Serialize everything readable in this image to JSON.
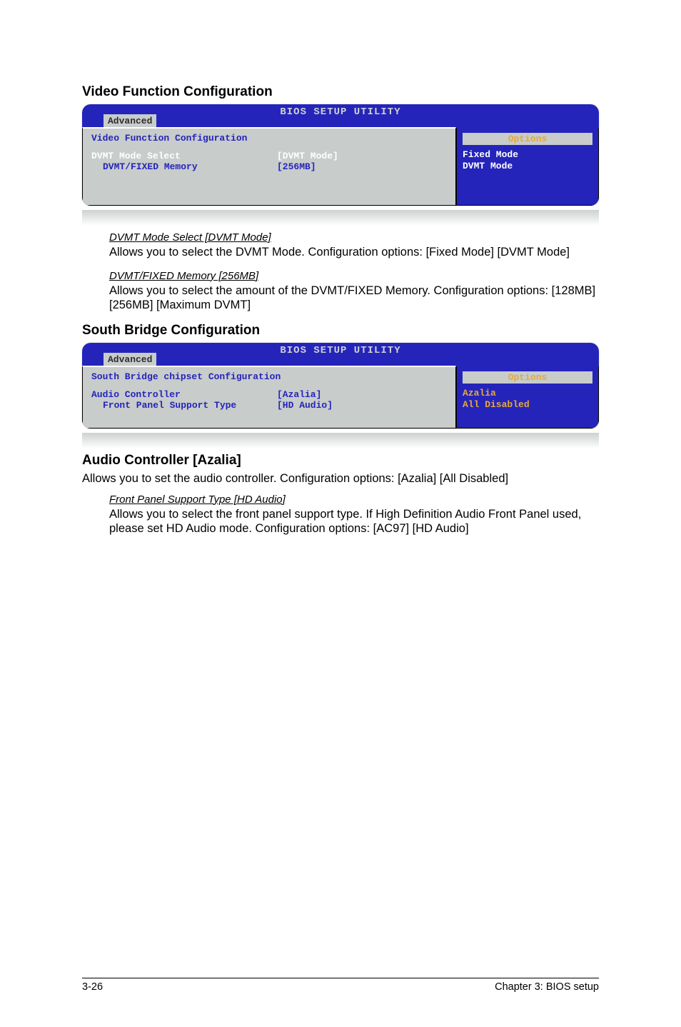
{
  "section1": {
    "heading": "Video Function Configuration",
    "bios": {
      "headerTitle": "BIOS SETUP UTILITY",
      "tab": "Advanced",
      "panelTitle": "Video Function Configuration",
      "rows": [
        {
          "label": "DVMT Mode Select",
          "value": "[DVMT Mode]"
        },
        {
          "label": "DVMT/FIXED Memory",
          "value": "[256MB]"
        }
      ],
      "optionsLabel": "Options",
      "help": [
        "Fixed Mode",
        "DVMT Mode"
      ]
    },
    "items": [
      {
        "title": "DVMT Mode Select [DVMT Mode]",
        "body": "Allows you to select the DVMT Mode. Configuration options: [Fixed Mode] [DVMT Mode]"
      },
      {
        "title": "DVMT/FIXED Memory [256MB]",
        "body": "Allows you to select the amount of the DVMT/FIXED Memory. Configuration options: [128MB] [256MB] [Maximum DVMT]"
      }
    ]
  },
  "section2": {
    "heading": "South Bridge Configuration",
    "bios": {
      "headerTitle": "BIOS SETUP UTILITY",
      "tab": "Advanced",
      "panelTitle": "South Bridge chipset Configuration",
      "rows": [
        {
          "label": "Audio Controller",
          "value": "[Azalia]"
        },
        {
          "label": "Front Panel Support Type",
          "value": "[HD Audio]"
        }
      ],
      "optionsLabel": "Options",
      "help": [
        "Azalia",
        "All Disabled"
      ]
    }
  },
  "section3": {
    "heading": "Audio Controller [Azalia]",
    "body": "Allows you to set the audio controller. Configuration options: [Azalia] [All Disabled]",
    "items": [
      {
        "title": " Front Panel Support Type [HD Audio]",
        "body": "Allows you to select the front panel support type. If High Definition Audio Front Panel used, please set HD Audio mode. Configuration options: [AC97] [HD Audio]"
      }
    ]
  },
  "footer": {
    "left": "3-26",
    "right": "Chapter 3: BIOS setup"
  }
}
